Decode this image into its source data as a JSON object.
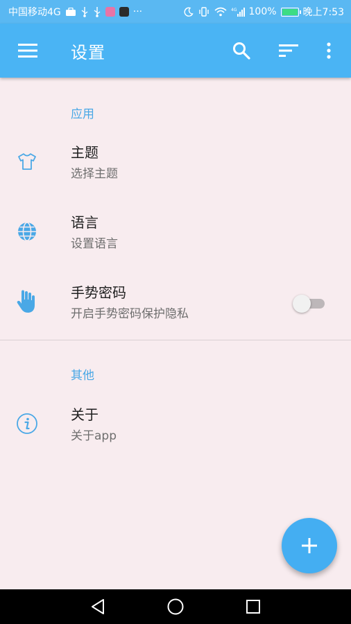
{
  "status_bar": {
    "carrier": "中国移动4G",
    "battery": "100%",
    "battery_level": 1.0,
    "time": "晚上7:53",
    "more": "···",
    "signal_label": "4G"
  },
  "app_bar": {
    "title": "设置",
    "color": "#4ab4f4",
    "actions": [
      "menu-icon",
      "search-icon",
      "sort-icon",
      "more-vert-icon"
    ]
  },
  "sections": [
    {
      "header": "应用",
      "items": [
        {
          "title": "主题",
          "subtitle": "选择主题",
          "icon": "tshirt-icon"
        },
        {
          "title": "语言",
          "subtitle": "设置语言",
          "icon": "globe-icon"
        },
        {
          "title": "手势密码",
          "subtitle": "开启手势密码保护隐私",
          "icon": "hand-icon",
          "toggle_on": false
        }
      ]
    },
    {
      "header": "其他",
      "items": [
        {
          "title": "关于",
          "subtitle": "关于app",
          "icon": "info-icon"
        }
      ]
    }
  ],
  "fab": {
    "label": "+",
    "icon": "add-icon"
  },
  "accent_color": "#4aa8e6"
}
